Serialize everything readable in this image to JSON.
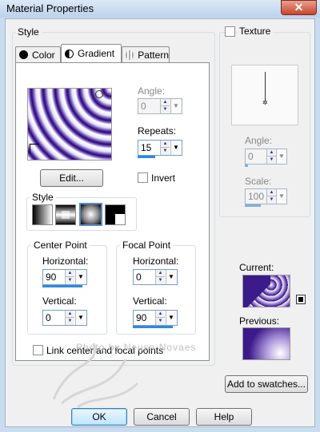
{
  "window": {
    "title": "Material Properties",
    "close_glyph": "✕"
  },
  "style_group": {
    "legend": "Style"
  },
  "tabs": [
    {
      "label": "Color",
      "icon": "solid-color-icon"
    },
    {
      "label": "Gradient",
      "icon": "gradient-icon"
    },
    {
      "label": "Pattern",
      "icon": "pattern-icon"
    }
  ],
  "gradient": {
    "angle_label": "Angle:",
    "angle_value": "0",
    "repeats_label": "Repeats:",
    "repeats_value": "15",
    "invert_label": "Invert",
    "edit_label": "Edit...",
    "style_label": "Style",
    "center_point": {
      "legend": "Center Point",
      "h_label": "Horizontal:",
      "h_value": "90",
      "v_label": "Vertical:",
      "v_value": "0"
    },
    "focal_point": {
      "legend": "Focal Point",
      "h_label": "Horizontal:",
      "h_value": "0",
      "v_label": "Vertical:",
      "v_value": "90"
    },
    "link_label": "Link center and focal points"
  },
  "texture": {
    "label": "Texture",
    "angle_label": "Angle:",
    "angle_value": "0",
    "scale_label": "Scale:",
    "scale_value": "100"
  },
  "preview": {
    "current_label": "Current:",
    "previous_label": "Previous:"
  },
  "watermark": "Photo by Neusa Novaes",
  "buttons": {
    "add_swatches": "Add to swatches...",
    "ok": "OK",
    "cancel": "Cancel",
    "help": "Help"
  },
  "colors": {
    "purple": "#3b1a8a",
    "accent": "#2e8ae0"
  }
}
